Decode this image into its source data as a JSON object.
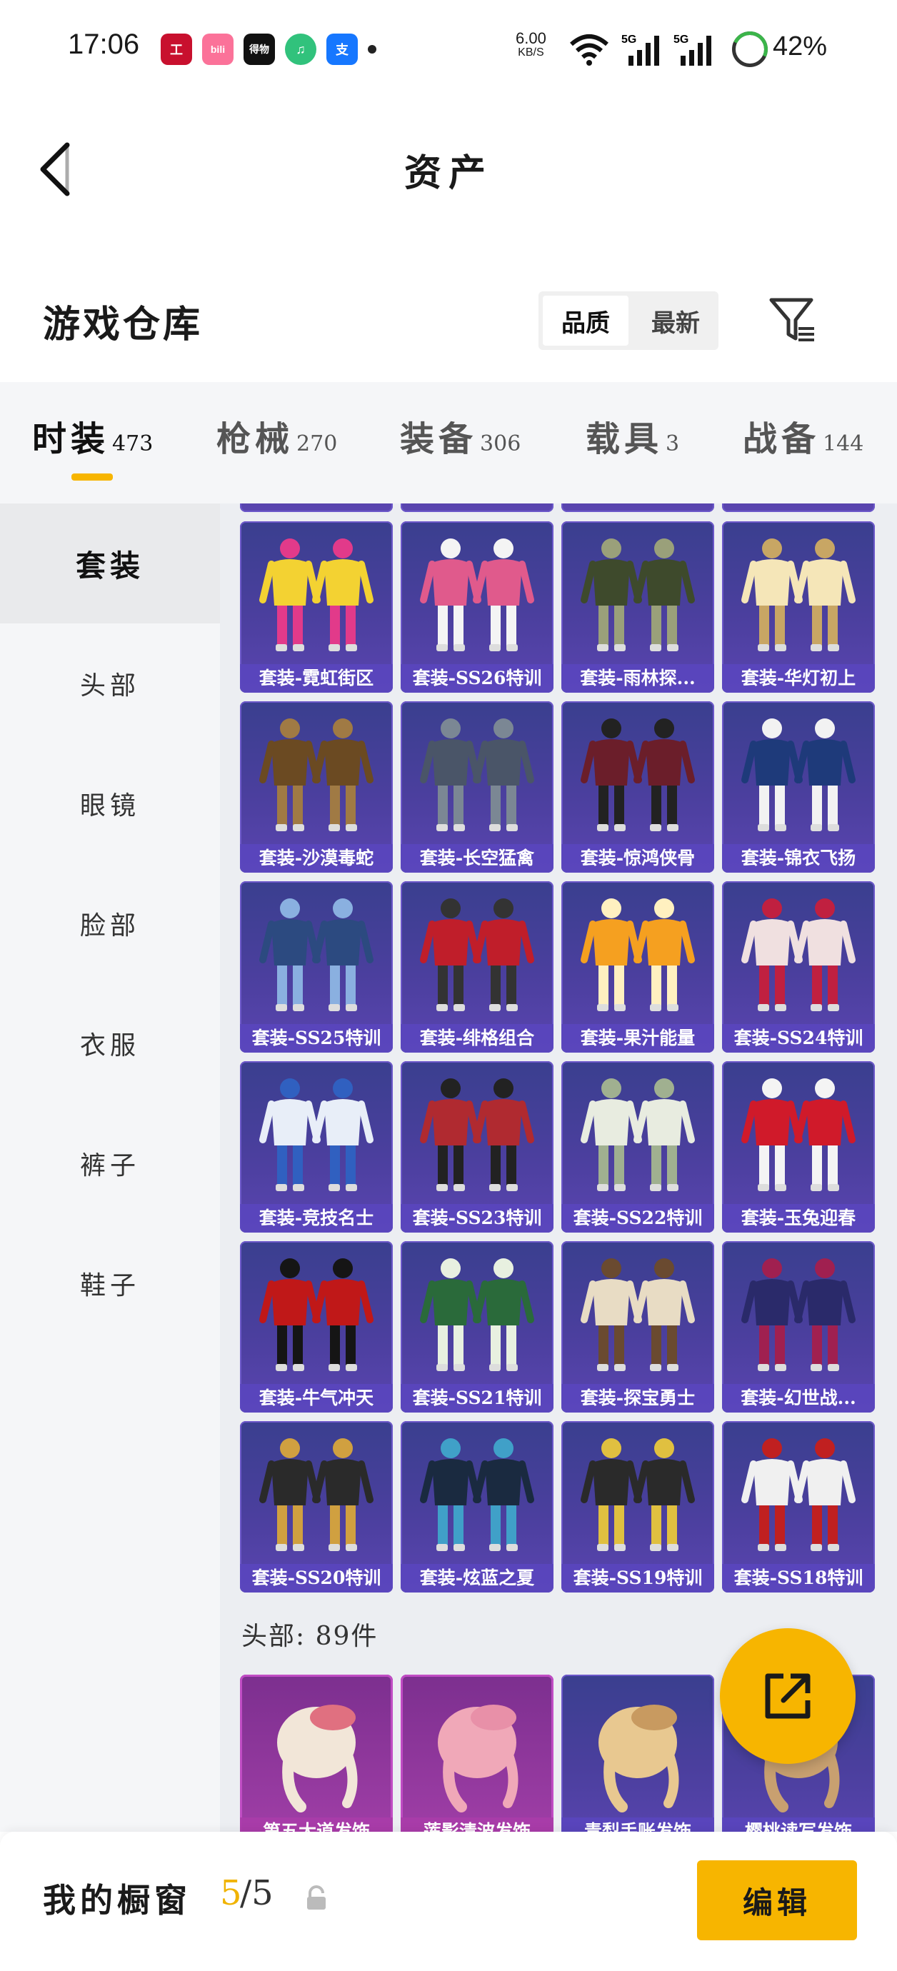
{
  "status_bar": {
    "time": "17:06",
    "apps": [
      {
        "icon": "icbc-icon",
        "text": "工",
        "color": "#c8102e"
      },
      {
        "icon": "bilibili-icon",
        "text": "bili",
        "color": "#fb7299"
      },
      {
        "icon": "game-icon",
        "text": "得物",
        "color": "#111111"
      },
      {
        "icon": "qq-music-icon",
        "text": "♫",
        "color": "#31c27c"
      },
      {
        "icon": "alipay-icon",
        "text": "支",
        "color": "#1677ff"
      }
    ],
    "net_speed": "6.00",
    "net_unit": "KB/S",
    "signal_1": "5G",
    "signal_2": "5G",
    "battery": "42%"
  },
  "header": {
    "title": "资产"
  },
  "warehouse": {
    "title": "游戏仓库",
    "sort": [
      "品质",
      "最新"
    ]
  },
  "categories": [
    {
      "name": "时装",
      "count": "473"
    },
    {
      "name": "枪械",
      "count": "270"
    },
    {
      "name": "装备",
      "count": "306"
    },
    {
      "name": "载具",
      "count": "3"
    },
    {
      "name": "战备",
      "count": "144"
    }
  ],
  "sidebar": {
    "items": [
      "套装",
      "头部",
      "眼镜",
      "脸部",
      "衣服",
      "裤子",
      "鞋子"
    ]
  },
  "grid": {
    "items": [
      "套装-霓虹街区",
      "套装-SS26特训",
      "套装-雨林探...",
      "套装-华灯初上",
      "套装-沙漠毒蛇",
      "套装-长空猛禽",
      "套装-惊鸿侠骨",
      "套装-锦衣飞扬",
      "套装-SS25特训",
      "套装-绯格组合",
      "套装-果汁能量",
      "套装-SS24特训",
      "套装-竞技名士",
      "套装-SS23特训",
      "套装-SS22特训",
      "套装-玉兔迎春",
      "套装-牛气冲天",
      "套装-SS21特训",
      "套装-探宝勇士",
      "套装-幻世战...",
      "套装-SS20特训",
      "套装-炫蓝之夏",
      "套装-SS19特训",
      "套装-SS18特训"
    ],
    "head_section": "头部: 89件",
    "head_items": [
      "第五大道发饰",
      "莲影清波发饰",
      "青梨手账发饰",
      "樱桃读写发饰"
    ]
  },
  "showcase": {
    "title": "我的橱窗",
    "current": "5",
    "total": "/5",
    "edit_label": "编辑"
  }
}
